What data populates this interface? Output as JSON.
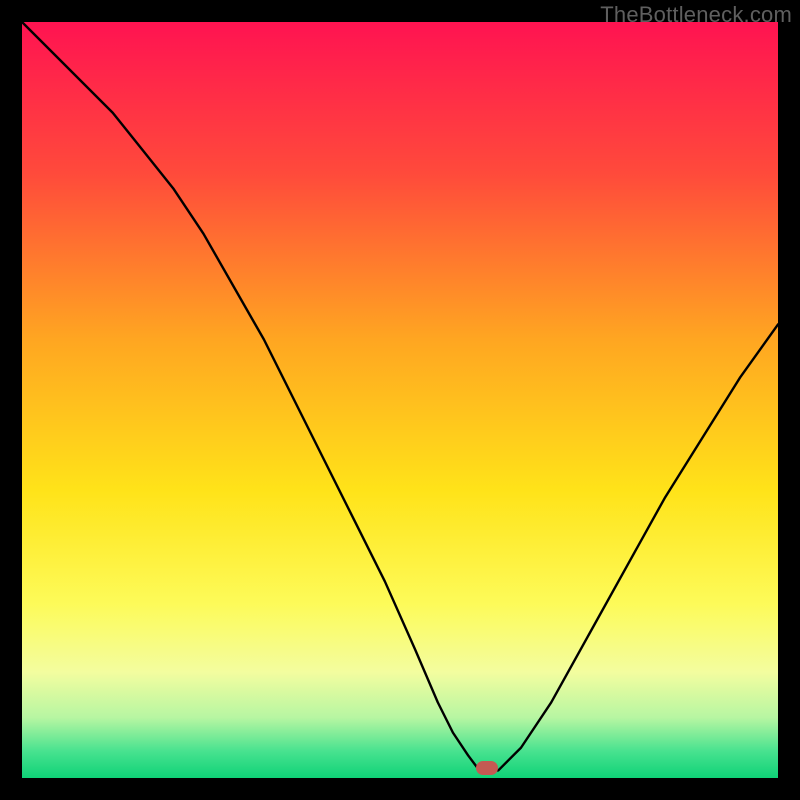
{
  "watermark": {
    "text": "TheBottleneck.com"
  },
  "chart_data": {
    "type": "line",
    "title": "",
    "xlabel": "",
    "ylabel": "",
    "xlim": [
      0,
      100
    ],
    "ylim": [
      0,
      100
    ],
    "grid": false,
    "legend": false,
    "background_gradient_stops": [
      {
        "pct": 0,
        "color": "#ff1351"
      },
      {
        "pct": 20,
        "color": "#ff4a3b"
      },
      {
        "pct": 42,
        "color": "#ffa621"
      },
      {
        "pct": 62,
        "color": "#ffe319"
      },
      {
        "pct": 77,
        "color": "#fdfb59"
      },
      {
        "pct": 86,
        "color": "#f3fd9f"
      },
      {
        "pct": 92,
        "color": "#b7f6a2"
      },
      {
        "pct": 96.5,
        "color": "#47e28f"
      },
      {
        "pct": 100,
        "color": "#0fd277"
      }
    ],
    "series": [
      {
        "name": "bottleneck-curve",
        "color": "#000000",
        "width": 2.4,
        "x": [
          0,
          4,
          8,
          12,
          16,
          20,
          24,
          28,
          32,
          36,
          40,
          44,
          48,
          52,
          55,
          57,
          59,
          60.5,
          63,
          66,
          70,
          75,
          80,
          85,
          90,
          95,
          100
        ],
        "y": [
          100,
          96,
          92,
          88,
          83,
          78,
          72,
          65,
          58,
          50,
          42,
          34,
          26,
          17,
          10,
          6,
          3,
          1,
          1,
          4,
          10,
          19,
          28,
          37,
          45,
          53,
          60
        ]
      }
    ],
    "marker": {
      "x": 61.5,
      "y": 1.3,
      "color": "#c45a53",
      "shape": "pill"
    }
  }
}
